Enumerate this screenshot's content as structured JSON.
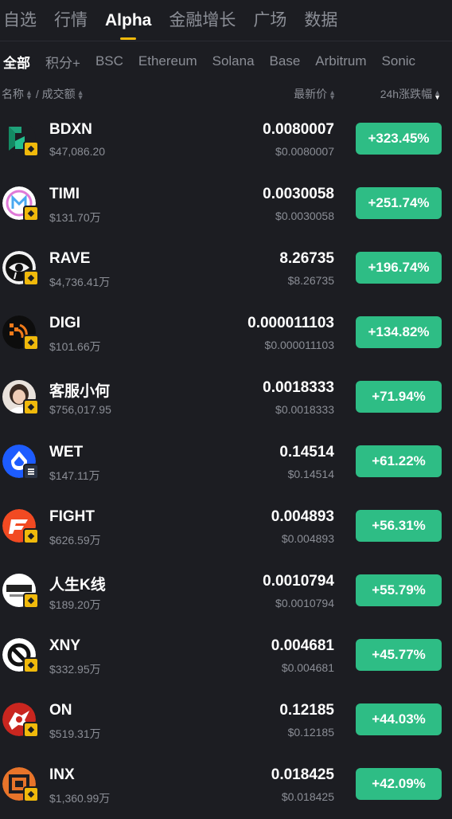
{
  "topnav": {
    "tabs": [
      {
        "label": "自选"
      },
      {
        "label": "行情"
      },
      {
        "label": "Alpha"
      },
      {
        "label": "金融增长"
      },
      {
        "label": "广场"
      },
      {
        "label": "数据"
      }
    ],
    "active": "Alpha"
  },
  "subnav": {
    "chips": [
      {
        "label": "全部"
      },
      {
        "label": "积分+"
      },
      {
        "label": "BSC"
      },
      {
        "label": "Ethereum"
      },
      {
        "label": "Solana"
      },
      {
        "label": "Base"
      },
      {
        "label": "Arbitrum"
      },
      {
        "label": "Sonic"
      }
    ],
    "active": "全部"
  },
  "columns": {
    "name": "名称",
    "separator": "/",
    "volume": "成交额",
    "price": "最新价",
    "change": "24h涨跌幅"
  },
  "rows": [
    {
      "symbol": "BDXN",
      "volume": "$47,086.20",
      "price": "0.0080007",
      "usd_price": "$0.0080007",
      "change": "+323.45%",
      "icon": "bdxn-logo-icon"
    },
    {
      "symbol": "TIMI",
      "volume": "$131.70万",
      "price": "0.0030058",
      "usd_price": "$0.0030058",
      "change": "+251.74%",
      "icon": "timi-logo-icon"
    },
    {
      "symbol": "RAVE",
      "volume": "$4,736.41万",
      "price": "8.26735",
      "usd_price": "$8.26735",
      "change": "+196.74%",
      "icon": "rave-logo-icon"
    },
    {
      "symbol": "DIGI",
      "volume": "$101.66万",
      "price": "0.000011103",
      "usd_price": "$0.000011103",
      "change": "+134.82%",
      "icon": "digi-logo-icon"
    },
    {
      "symbol": "客服小何",
      "volume": "$756,017.95",
      "price": "0.0018333",
      "usd_price": "$0.0018333",
      "change": "+71.94%",
      "icon": "person-avatar-icon"
    },
    {
      "symbol": "WET",
      "volume": "$147.11万",
      "price": "0.14514",
      "usd_price": "$0.14514",
      "change": "+61.22%",
      "icon": "wet-logo-icon"
    },
    {
      "symbol": "FIGHT",
      "volume": "$626.59万",
      "price": "0.004893",
      "usd_price": "$0.004893",
      "change": "+56.31%",
      "icon": "fight-logo-icon"
    },
    {
      "symbol": "人生K线",
      "volume": "$189.20万",
      "price": "0.0010794",
      "usd_price": "$0.0010794",
      "change": "+55.79%",
      "icon": "kline-logo-icon"
    },
    {
      "symbol": "XNY",
      "volume": "$332.95万",
      "price": "0.004681",
      "usd_price": "$0.004681",
      "change": "+45.77%",
      "icon": "xny-logo-icon"
    },
    {
      "symbol": "ON",
      "volume": "$519.31万",
      "price": "0.12185",
      "usd_price": "$0.12185",
      "change": "+44.03%",
      "icon": "on-logo-icon"
    },
    {
      "symbol": "INX",
      "volume": "$1,360.99万",
      "price": "0.018425",
      "usd_price": "$0.018425",
      "change": "+42.09%",
      "icon": "inx-logo-icon"
    }
  ],
  "colors": {
    "background": "#1c1d22",
    "accent": "#f0b90b",
    "up": "#2ebd85",
    "muted": "#8b8e96"
  }
}
